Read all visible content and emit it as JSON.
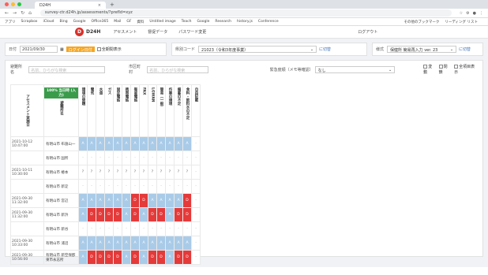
{
  "browser": {
    "tab_title": "D24H",
    "url": "survey-ctr.d24h.jp/assessments/?prefId=xyz",
    "bookmarks": [
      "アプリ",
      "Scrapbox",
      "iCloud",
      "Bing",
      "Google",
      "Office365",
      "Mail",
      "GF",
      "資料",
      "Untitled image",
      "Teach",
      "Google",
      "Research",
      "history.js",
      "Conference"
    ],
    "bookmarks_right": [
      "その他のブックマーク",
      "リーディング リスト"
    ]
  },
  "app": {
    "logo_letter": "D",
    "brand": "D24H",
    "nav": [
      "アセスメント",
      "督促データ",
      "パスワード変更"
    ],
    "logout": "ログアウト"
  },
  "filters": {
    "date_label": "日付",
    "date_value": "2021/09/30",
    "btn_orange": "ログイン日付",
    "show_all_label": "全期間表示",
    "pref_code_label": "県別コード",
    "pref_code_value": "21023（令和3年度事業）",
    "pref_switch": "に切替",
    "sheet_label": "様式",
    "sheet_value": "保健所 簡易再入力 ver. 23",
    "sheet_switch": "に切替"
  },
  "search": {
    "facility_label": "避難所名",
    "facility_placeholder": "名前、ひらがな検索",
    "city_label": "市区町村",
    "city_placeholder": "名前、ひらがな検索",
    "priority_label": "緊急度順（メモ等確認）",
    "priority_value": "なし",
    "opt1": "変動",
    "opt2": "閉鎖",
    "opt3": "全項目表示"
  },
  "table": {
    "col_assess": "アセスメント実施日",
    "green_btn": "100% 当日時 (入力)",
    "col_name": "避難所名",
    "items": [
      "環境の問題",
      "電気",
      "水道",
      "ガス",
      "固定電話",
      "携帯電話",
      "衛星電話",
      "FAX",
      "LGWAN",
      "簡易（一般）",
      "作業の環境",
      "備蓄の不足",
      "食料・飲料水の不足",
      "自由記載"
    ],
    "rows": [
      {
        "date": "2021-10-12 10:47:00",
        "name": "有明山市 布施山一",
        "cells": [
          "A",
          "A",
          "A",
          "A",
          "A",
          "A",
          "A",
          "A",
          "A",
          "A",
          "A",
          "A",
          "A",
          "-"
        ]
      },
      {
        "date": "",
        "name": "有明山市 国所",
        "cells": [
          "-",
          "-",
          "-",
          "-",
          "-",
          "-",
          "-",
          "-",
          "-",
          "-",
          "-",
          "-",
          "-",
          "-"
        ]
      },
      {
        "date": "2021-10-11 10:30:00",
        "name": "有明山市 椿本",
        "cells": [
          "?",
          "?",
          "?",
          "?",
          "?",
          "?",
          "?",
          "?",
          "?",
          "?",
          "?",
          "?",
          "?",
          "-"
        ]
      },
      {
        "date": "",
        "name": "有明山市 新淀",
        "cells": [
          "-",
          "-",
          "-",
          "-",
          "-",
          "-",
          "-",
          "-",
          "-",
          "-",
          "-",
          "-",
          "-",
          "-"
        ]
      },
      {
        "date": "2021-09-30 11:32:00",
        "name": "有明山市 宮辺",
        "cells": [
          "A",
          "A",
          "A",
          "A",
          "A",
          "A",
          "D",
          "D",
          "A",
          "A",
          "A",
          "A",
          "D",
          "-"
        ]
      },
      {
        "date": "2021-09-30 11:32:00",
        "name": "有明山市 新浜",
        "cells": [
          "A",
          "D",
          "D",
          "D",
          "D",
          "A",
          "D",
          "A",
          "D",
          "D",
          "A",
          "D",
          "D",
          "-"
        ]
      },
      {
        "date": "",
        "name": "有明山市 新谷",
        "cells": [
          "-",
          "-",
          "-",
          "-",
          "-",
          "-",
          "-",
          "-",
          "-",
          "-",
          "-",
          "-",
          "-",
          "-"
        ]
      },
      {
        "date": "2021-09-30 10:33:00",
        "name": "有明山市 浦沼",
        "cells": [
          "A",
          "A",
          "A",
          "A",
          "A",
          "A",
          "A",
          "A",
          "A",
          "A",
          "A",
          "A",
          "A",
          "-"
        ]
      },
      {
        "date": "2021-09-30 10:56:00",
        "name": "有明山市 新空保郡 東市永志所",
        "cells": [
          "A",
          "D",
          "D",
          "D",
          "D",
          "A",
          "D",
          "A",
          "D",
          "D",
          "A",
          "D",
          "D",
          "-"
        ]
      }
    ]
  },
  "colors": {
    "status_ok": "#a9cbe8",
    "status_danger": "#e43a3a",
    "accent": "#f5a623"
  }
}
